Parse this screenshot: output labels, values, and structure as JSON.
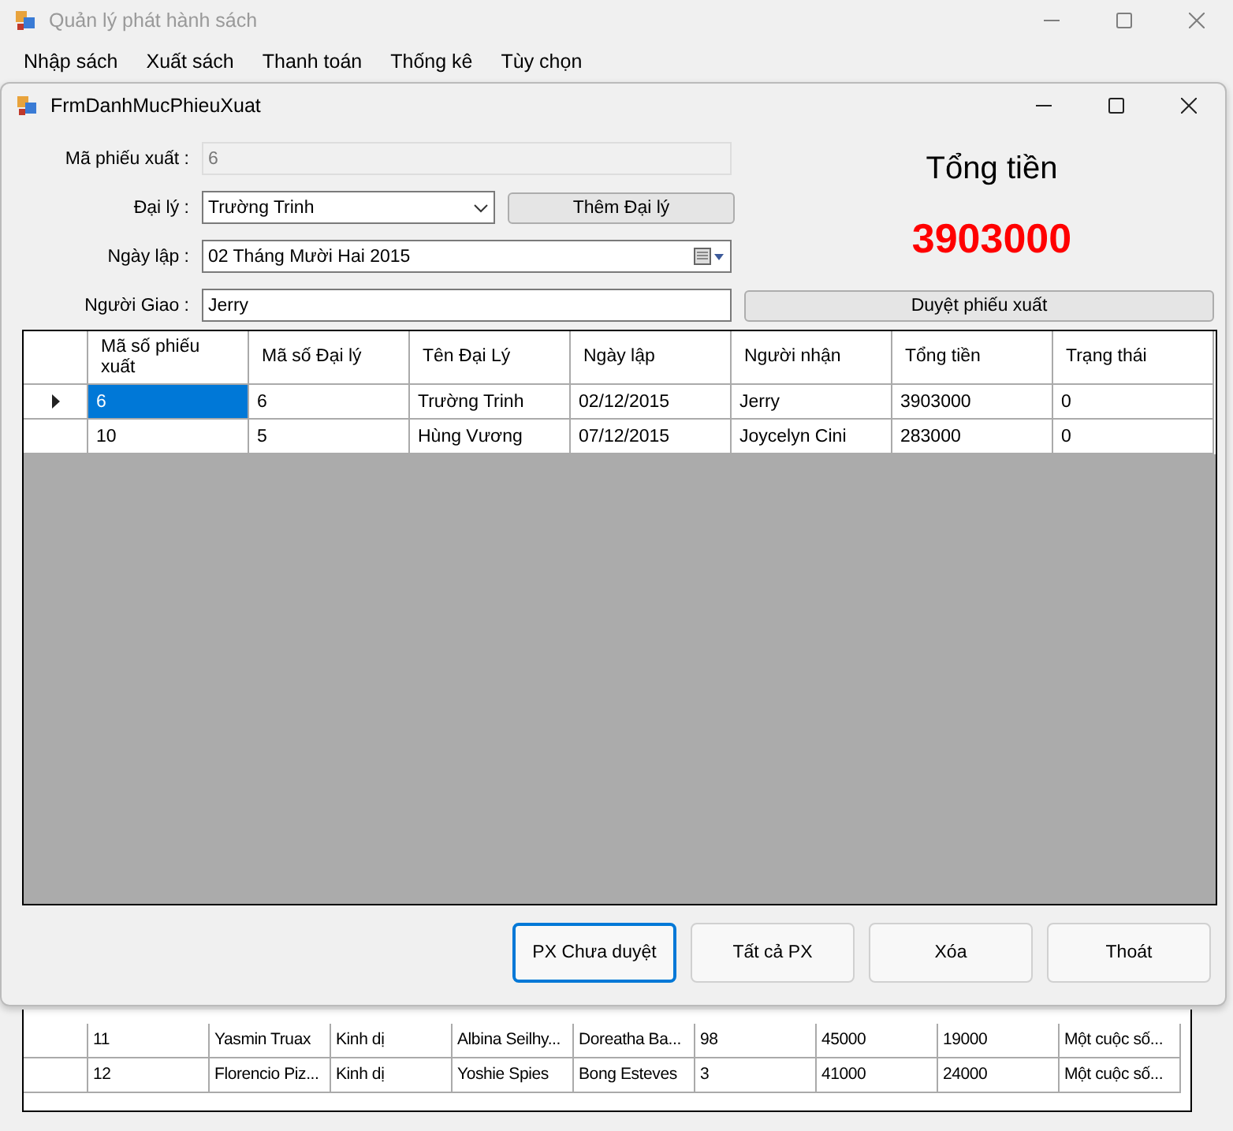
{
  "window": {
    "title": "Quản lý phát hành sách"
  },
  "menu": [
    "Nhập sách",
    "Xuất sách",
    "Thanh toán",
    "Thống kê",
    "Tùy chọn"
  ],
  "dialog": {
    "title": "FrmDanhMucPhieuXuat",
    "fields": [
      {
        "kind": "readonly",
        "label": "Mã phiếu xuất :",
        "value": "6"
      },
      {
        "kind": "combo",
        "label": "Đại lý :",
        "value": "Trường Trinh",
        "button": "Thêm Đại lý"
      },
      {
        "kind": "date",
        "label": "Ngày lập :",
        "value": "02 Tháng Mười Hai 2015"
      },
      {
        "kind": "text",
        "label": "Người Giao  :",
        "value": "Jerry",
        "button": "Duyệt phiếu xuất"
      }
    ],
    "total_label": "Tổng tiền",
    "total_value": "3903000",
    "table": {
      "columns": [
        "Mã số phiếu xuất",
        "Mã số Đại lý",
        "Tên Đại Lý",
        "Ngày lập",
        "Người nhận",
        "Tổng tiền",
        "Trạng thái"
      ],
      "rows": [
        {
          "selected": true,
          "cells": [
            "6",
            "6",
            "Trường Trinh",
            "02/12/2015",
            "Jerry",
            "3903000",
            "0"
          ]
        },
        {
          "selected": false,
          "cells": [
            "10",
            "5",
            "Hùng Vương",
            "07/12/2015",
            "Joycelyn Cini",
            "283000",
            "0"
          ]
        }
      ]
    },
    "buttons": [
      {
        "label": "PX Chưa duyệt",
        "focused": true
      },
      {
        "label": "Tất cả PX",
        "focused": false
      },
      {
        "label": "Xóa",
        "focused": false
      },
      {
        "label": "Thoát",
        "focused": false
      }
    ]
  },
  "background_table": {
    "rows": [
      [
        "11",
        "Yasmin Truax",
        "Kinh dị",
        "Albina Seilhy...",
        "Doreatha Ba...",
        "98",
        "45000",
        "19000",
        "Một cuộc số..."
      ],
      [
        "12",
        "Florencio Piz...",
        "Kinh dị",
        "Yoshie Spies",
        "Bong Esteves",
        "3",
        "41000",
        "24000",
        "Một cuộc số..."
      ]
    ]
  }
}
